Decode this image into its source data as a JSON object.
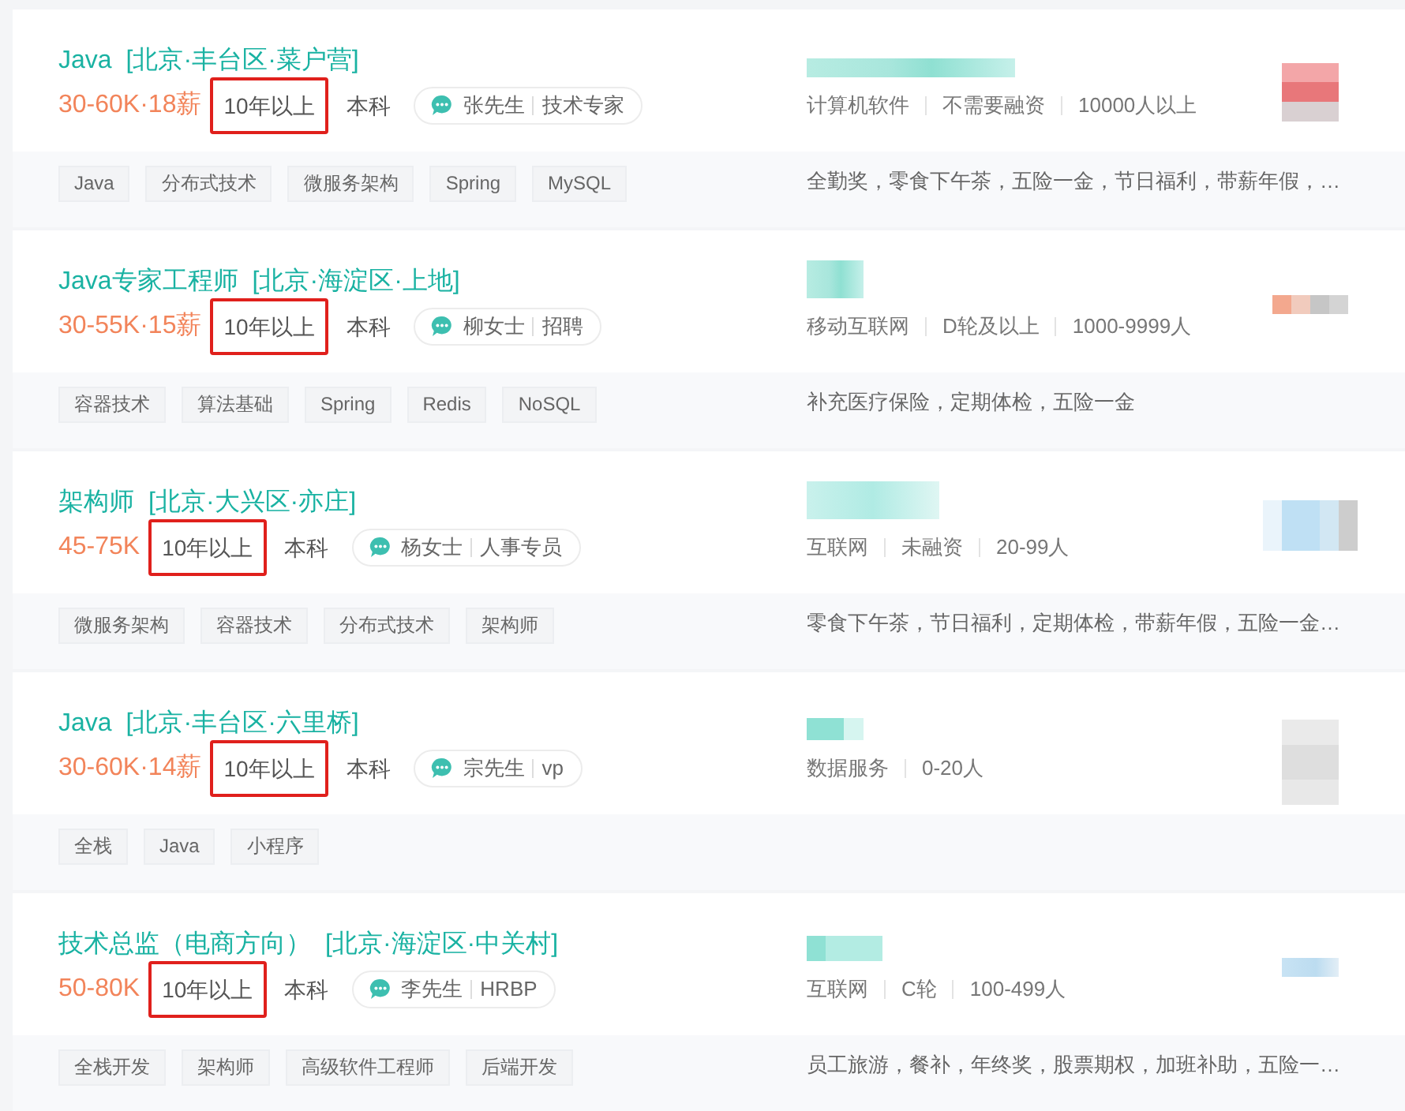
{
  "jobs": [
    {
      "title": "Java",
      "location": "[北京·丰台区·菜户营]",
      "salary": "30-60K·18薪",
      "experience": {
        "text": "10年以上",
        "highlighted": true
      },
      "education": "本科",
      "recruiter": {
        "name": "张先生",
        "role": "技术专家"
      },
      "company_info": [
        "计算机软件",
        "不需要融资",
        "10000人以上"
      ],
      "skills": [
        "Java",
        "分布式技术",
        "微服务架构",
        "Spring",
        "MySQL"
      ],
      "benefits": "全勤奖，零食下午茶，五险一金，节日福利，带薪年假，…"
    },
    {
      "title": "Java专家工程师",
      "location": "[北京·海淀区·上地]",
      "salary": "30-55K·15薪",
      "experience": {
        "text": "10年以上",
        "highlighted": true
      },
      "education": "本科",
      "recruiter": {
        "name": "柳女士",
        "role": "招聘"
      },
      "company_info": [
        "移动互联网",
        "D轮及以上",
        "1000-9999人"
      ],
      "skills": [
        "容器技术",
        "算法基础",
        "Spring",
        "Redis",
        "NoSQL"
      ],
      "benefits": "补充医疗保险，定期体检，五险一金"
    },
    {
      "title": "架构师",
      "location": "[北京·大兴区·亦庄]",
      "salary": "45-75K",
      "experience": {
        "text": "10年以上",
        "highlighted": true
      },
      "education": "本科",
      "recruiter": {
        "name": "杨女士",
        "role": "人事专员"
      },
      "company_info": [
        "互联网",
        "未融资",
        "20-99人"
      ],
      "skills": [
        "微服务架构",
        "容器技术",
        "分布式技术",
        "架构师"
      ],
      "benefits": "零食下午茶，节日福利，定期体检，带薪年假，五险一金…"
    },
    {
      "title": "Java",
      "location": "[北京·丰台区·六里桥]",
      "salary": "30-60K·14薪",
      "experience": {
        "text": "10年以上",
        "highlighted": true
      },
      "education": "本科",
      "recruiter": {
        "name": "宗先生",
        "role": "vp"
      },
      "company_info": [
        "数据服务",
        "0-20人"
      ],
      "skills": [
        "全栈",
        "Java",
        "小程序"
      ]
    },
    {
      "title": "技术总监（电商方向）",
      "location": "[北京·海淀区·中关村]",
      "salary": "50-80K",
      "experience": {
        "text": "10年以上",
        "highlighted": true
      },
      "education": "本科",
      "recruiter": {
        "name": "李先生",
        "role": "HRBP"
      },
      "company_info": [
        "互联网",
        "C轮",
        "100-499人"
      ],
      "skills": [
        "全栈开发",
        "架构师",
        "高级软件工程师",
        "后端开发"
      ],
      "benefits": "员工旅游，餐补，年终奖，股票期权，加班补助，五险一…"
    }
  ]
}
